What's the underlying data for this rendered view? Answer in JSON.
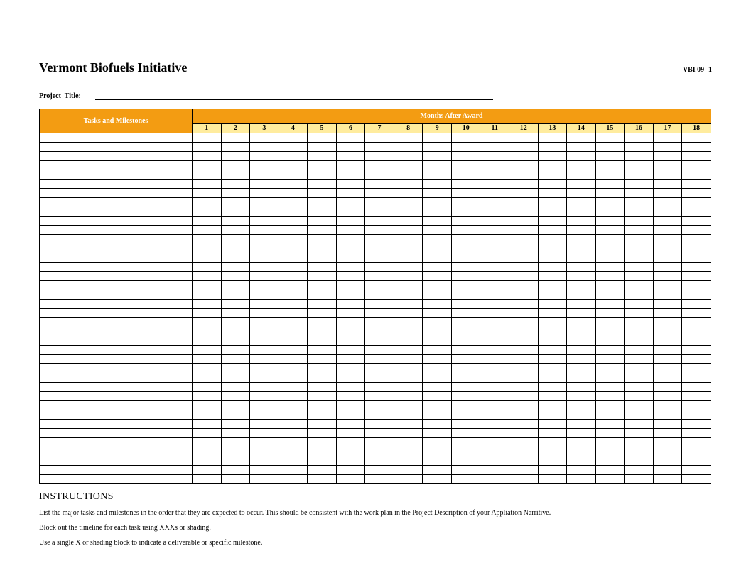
{
  "header": {
    "title": "Vermont Biofuels Initiative",
    "code": "VBI 09 -1"
  },
  "project_title": {
    "label": "Project  Title:",
    "value": ""
  },
  "table": {
    "tasks_header": "Tasks and Milestones",
    "months_header": "Months After Award",
    "months": [
      "1",
      "2",
      "3",
      "4",
      "5",
      "6",
      "7",
      "8",
      "9",
      "10",
      "11",
      "12",
      "13",
      "14",
      "15",
      "16",
      "17",
      "18"
    ],
    "row_count": 38
  },
  "instructions": {
    "heading": "INSTRUCTIONS",
    "lines": [
      "List the major tasks and milestones in the order that they are expected to occur. This should be consistent with the work plan in the Project Description of your Appliation Narritive.",
      "Block out the timeline for each task using XXXs or shading.",
      "Use a single X or shading block to indicate a deliverable or specific milestone."
    ]
  }
}
